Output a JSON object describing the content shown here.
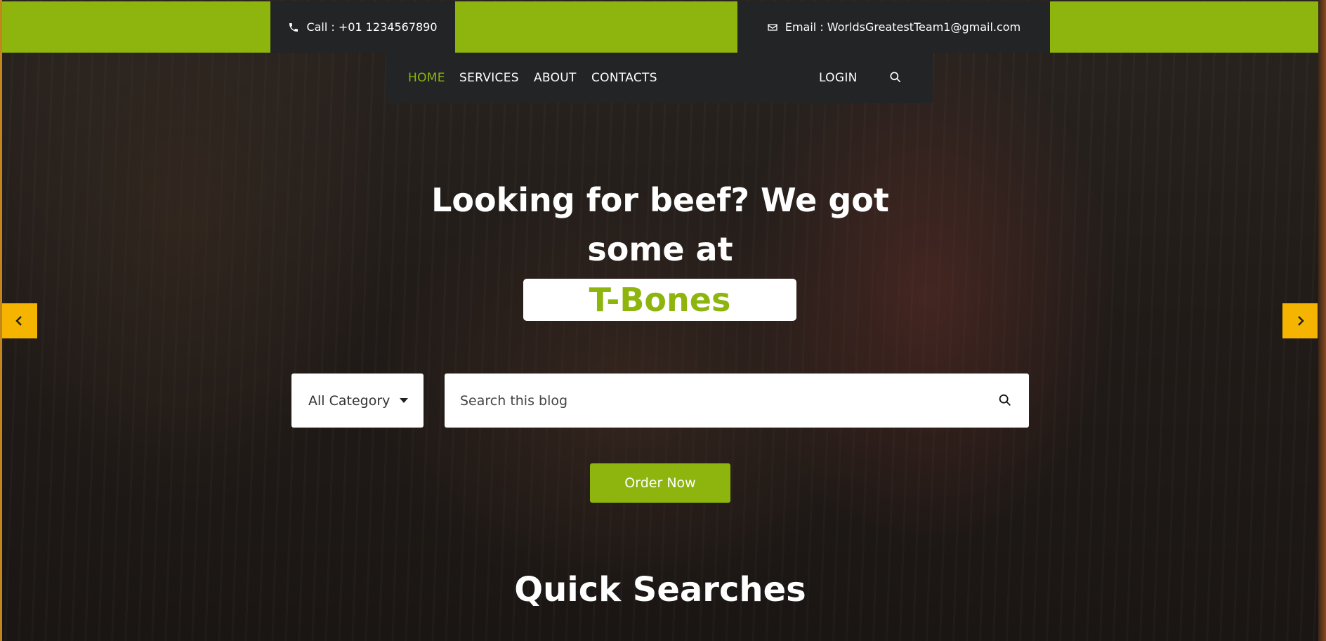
{
  "top_bar": {
    "call_text": "Call : +01 1234567890",
    "email_text": "Email : WorldsGreatestTeam1@gmail.com",
    "accent_color": "#8db50e"
  },
  "nav": {
    "items": [
      {
        "label": "HOME",
        "active": true
      },
      {
        "label": "SERVICES",
        "active": false
      },
      {
        "label": "ABOUT",
        "active": false
      },
      {
        "label": "CONTACTS",
        "active": false
      }
    ],
    "login_label": "LOGIN",
    "search_icon": "search-icon"
  },
  "hero": {
    "title": "Looking for beef? We got some at",
    "brand": "T-Bones",
    "prev_icon": "chevron-left-icon",
    "next_icon": "chevron-right-icon",
    "carousel_arrow_color": "#f4b400"
  },
  "search": {
    "category_value": "All Category",
    "placeholder": "Search this blog",
    "value": ""
  },
  "cta": {
    "order_label": "Order Now"
  },
  "sections": {
    "quick_searches_title": "Quick Searches"
  }
}
